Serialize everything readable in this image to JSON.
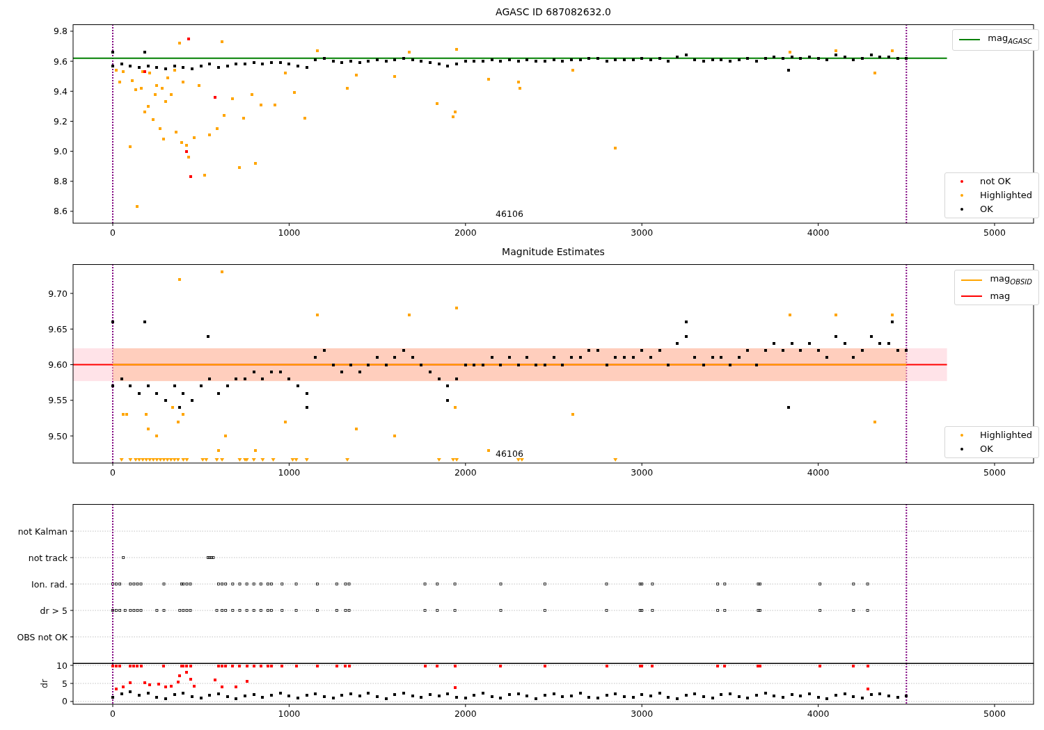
{
  "panels": [
    {
      "chart_data": {
        "type": "scatter",
        "title": "AGASC ID 687082632.0",
        "xlim": [
          -225,
          5221
        ],
        "ylim": [
          8.521,
          9.846
        ],
        "xticks": [
          0,
          1000,
          2000,
          3000,
          4000,
          5000
        ],
        "yticks": [
          {
            "value": 8.6,
            "label": "8.6"
          },
          {
            "value": 8.8,
            "label": "8.8"
          },
          {
            "value": 9.0,
            "label": "9.0"
          },
          {
            "value": 9.2,
            "label": "9.2"
          },
          {
            "value": 9.4,
            "label": "9.4"
          },
          {
            "value": 9.6,
            "label": "9.6"
          },
          {
            "value": 9.8,
            "label": "9.8"
          }
        ],
        "series": [
          {
            "name": "not OK",
            "color": "#ff0000",
            "x": [
              180,
              420,
              430,
              440,
              580
            ],
            "values": [
              9.53,
              9.0,
              9.75,
              8.83,
              9.36
            ]
          },
          {
            "name": "Highlighted",
            "color": "#ffa500",
            "x": [
              20,
              40,
              60,
              100,
              110,
              130,
              140,
              160,
              170,
              180,
              200,
              210,
              230,
              240,
              250,
              270,
              280,
              290,
              300,
              310,
              330,
              350,
              360,
              380,
              390,
              400,
              420,
              430,
              460,
              490,
              520,
              550,
              590,
              620,
              630,
              680,
              720,
              740,
              790,
              810,
              840,
              920,
              980,
              1030,
              1090,
              1160,
              1330,
              1380,
              1600,
              1680,
              1840,
              1930,
              1940,
              1950,
              2130,
              2300,
              2310,
              2610,
              2850,
              3840,
              4100,
              4320,
              4420
            ],
            "values": [
              9.54,
              9.46,
              9.53,
              9.03,
              9.47,
              9.41,
              8.63,
              9.42,
              9.53,
              9.26,
              9.3,
              9.52,
              9.21,
              9.38,
              9.44,
              9.15,
              9.42,
              9.08,
              9.33,
              9.49,
              9.38,
              9.54,
              9.13,
              9.72,
              9.06,
              9.46,
              9.04,
              8.96,
              9.09,
              9.44,
              8.84,
              9.11,
              9.15,
              9.73,
              9.24,
              9.35,
              8.89,
              9.22,
              9.38,
              8.92,
              9.31,
              9.31,
              9.52,
              9.39,
              9.22,
              9.67,
              9.42,
              9.51,
              9.5,
              9.66,
              9.32,
              9.23,
              9.26,
              9.68,
              9.48,
              9.46,
              9.42,
              9.54,
              9.02,
              9.66,
              9.67,
              9.52,
              9.67
            ]
          },
          {
            "name": "OK",
            "color": "#000000",
            "x": [
              0,
              50,
              100,
              150,
              200,
              250,
              300,
              350,
              400,
              450,
              500,
              550,
              600,
              650,
              700,
              750,
              800,
              850,
              900,
              950,
              1000,
              1050,
              1100,
              1150,
              1200,
              1250,
              1300,
              1350,
              1400,
              1450,
              1500,
              1550,
              1600,
              1650,
              1700,
              1750,
              1800,
              1850,
              1900,
              1950,
              2000,
              2050,
              2100,
              2150,
              2200,
              2250,
              2300,
              2350,
              2400,
              2450,
              2500,
              2550,
              2600,
              2650,
              2700,
              2750,
              2800,
              2850,
              2900,
              2950,
              3000,
              3050,
              3100,
              3150,
              3200,
              3250,
              3300,
              3350,
              3400,
              3450,
              3500,
              3550,
              3600,
              3650,
              3700,
              3750,
              3800,
              3850,
              3900,
              3950,
              4000,
              4050,
              4100,
              4150,
              4200,
              4250,
              4300,
              4350,
              4400,
              4450,
              4500,
              0,
              180,
              3830
            ],
            "values": [
              9.57,
              9.58,
              9.57,
              9.56,
              9.57,
              9.56,
              9.55,
              9.57,
              9.56,
              9.55,
              9.57,
              9.58,
              9.56,
              9.57,
              9.58,
              9.58,
              9.59,
              9.58,
              9.59,
              9.59,
              9.58,
              9.57,
              9.56,
              9.61,
              9.62,
              9.6,
              9.59,
              9.6,
              9.59,
              9.6,
              9.61,
              9.6,
              9.61,
              9.62,
              9.61,
              9.6,
              9.59,
              9.58,
              9.57,
              9.58,
              9.6,
              9.6,
              9.6,
              9.61,
              9.6,
              9.61,
              9.6,
              9.61,
              9.6,
              9.6,
              9.61,
              9.6,
              9.61,
              9.61,
              9.62,
              9.62,
              9.6,
              9.61,
              9.61,
              9.61,
              9.62,
              9.61,
              9.62,
              9.6,
              9.63,
              9.64,
              9.61,
              9.6,
              9.61,
              9.61,
              9.6,
              9.61,
              9.62,
              9.6,
              9.62,
              9.63,
              9.62,
              9.63,
              9.62,
              9.63,
              9.62,
              9.61,
              9.64,
              9.63,
              9.61,
              9.62,
              9.64,
              9.63,
              9.63,
              9.62,
              9.62,
              9.66,
              9.66,
              9.54
            ]
          }
        ],
        "ref_lines": [
          {
            "axis": "y",
            "value": 9.62,
            "label": "mag$_{AGASC}$",
            "color": "#008000"
          },
          {
            "axis": "x",
            "value": 0,
            "color": "#800080"
          },
          {
            "axis": "x",
            "value": 4500,
            "color": "#800080"
          }
        ],
        "annotations": [
          "46106"
        ]
      }
    },
    {
      "chart_data": {
        "type": "scatter",
        "title": "Magnitude Estimates",
        "xlim": [
          -225,
          5221
        ],
        "ylim": [
          9.462,
          9.741
        ],
        "xticks": [
          0,
          1000,
          2000,
          3000,
          4000,
          5000
        ],
        "yticks": [
          {
            "value": 9.5,
            "label": "9.50"
          },
          {
            "value": 9.55,
            "label": "9.55"
          },
          {
            "value": 9.6,
            "label": "9.60"
          },
          {
            "value": 9.65,
            "label": "9.65"
          },
          {
            "value": 9.7,
            "label": "9.70"
          }
        ],
        "series": [
          {
            "name": "Highlighted",
            "color": "#ffa500",
            "x": [
              60,
              80,
              190,
              200,
              250,
              340,
              370,
              380,
              400,
              620,
              640,
              600,
              810,
              980,
              1160,
              1380,
              1600,
              1680,
              1940,
              1950,
              2130,
              2610,
              3840,
              4100,
              4320,
              4420
            ],
            "values": [
              9.53,
              9.53,
              9.53,
              9.51,
              9.5,
              9.54,
              9.52,
              9.72,
              9.53,
              9.73,
              9.5,
              9.48,
              9.48,
              9.52,
              9.67,
              9.51,
              9.5,
              9.67,
              9.54,
              9.68,
              9.48,
              9.53,
              9.67,
              9.67,
              9.52,
              9.67
            ]
          },
          {
            "name": "OK",
            "color": "#000000",
            "x": [
              0,
              50,
              100,
              150,
              200,
              250,
              300,
              350,
              400,
              450,
              500,
              550,
              600,
              650,
              700,
              750,
              800,
              850,
              900,
              950,
              1000,
              1050,
              1100,
              1150,
              1200,
              1250,
              1300,
              1350,
              1400,
              1450,
              1500,
              1550,
              1600,
              1650,
              1700,
              1750,
              1800,
              1850,
              1900,
              1950,
              2000,
              2050,
              2100,
              2150,
              2200,
              2250,
              2300,
              2350,
              2400,
              2450,
              2500,
              2550,
              2600,
              2650,
              2700,
              2750,
              2800,
              2850,
              2900,
              2950,
              3000,
              3050,
              3100,
              3150,
              3200,
              3250,
              3300,
              3350,
              3400,
              3450,
              3500,
              3550,
              3600,
              3650,
              3700,
              3750,
              3800,
              3850,
              3900,
              3950,
              4000,
              4050,
              4100,
              4150,
              4200,
              4250,
              4300,
              4350,
              4400,
              4450,
              4500,
              0,
              180,
              540,
              3830,
              1100,
              380,
              1900,
              3250,
              4420
            ],
            "values": [
              9.57,
              9.58,
              9.57,
              9.56,
              9.57,
              9.56,
              9.55,
              9.57,
              9.56,
              9.55,
              9.57,
              9.58,
              9.56,
              9.57,
              9.58,
              9.58,
              9.59,
              9.58,
              9.59,
              9.59,
              9.58,
              9.57,
              9.56,
              9.61,
              9.62,
              9.6,
              9.59,
              9.6,
              9.59,
              9.6,
              9.61,
              9.6,
              9.61,
              9.62,
              9.61,
              9.6,
              9.59,
              9.58,
              9.57,
              9.58,
              9.6,
              9.6,
              9.6,
              9.61,
              9.6,
              9.61,
              9.6,
              9.61,
              9.6,
              9.6,
              9.61,
              9.6,
              9.61,
              9.61,
              9.62,
              9.62,
              9.6,
              9.61,
              9.61,
              9.61,
              9.62,
              9.61,
              9.62,
              9.6,
              9.63,
              9.64,
              9.61,
              9.6,
              9.61,
              9.61,
              9.6,
              9.61,
              9.62,
              9.6,
              9.62,
              9.63,
              9.62,
              9.63,
              9.62,
              9.63,
              9.62,
              9.61,
              9.64,
              9.63,
              9.61,
              9.62,
              9.64,
              9.63,
              9.63,
              9.62,
              9.62,
              9.66,
              9.66,
              9.64,
              9.54,
              9.54,
              9.54,
              9.55,
              9.66,
              9.66
            ]
          },
          {
            "color": "#ffa500",
            "marker": "v",
            "x": [
              50,
              100,
              130,
              150,
              170,
              190,
              210,
              230,
              250,
              270,
              290,
              310,
              330,
              350,
              370,
              400,
              420,
              510,
              530,
              590,
              620,
              720,
              750,
              760,
              800,
              850,
              910,
              1020,
              1040,
              1100,
              1330,
              1850,
              1930,
              1950,
              2300,
              2320,
              2850
            ],
            "values": [
              9.466,
              9.466,
              9.466,
              9.466,
              9.466,
              9.466,
              9.466,
              9.466,
              9.466,
              9.466,
              9.466,
              9.466,
              9.466,
              9.466,
              9.466,
              9.466,
              9.466,
              9.466,
              9.466,
              9.466,
              9.466,
              9.466,
              9.466,
              9.466,
              9.466,
              9.466,
              9.466,
              9.466,
              9.466,
              9.466,
              9.466,
              9.466,
              9.466,
              9.466,
              9.466,
              9.466,
              9.466
            ]
          }
        ],
        "bands": [
          {
            "axis": "y",
            "from": 9.577,
            "to": 9.623,
            "color": "#ffc0cb"
          },
          {
            "axis": "y",
            "from": 9.577,
            "to": 9.623,
            "color": "#ffb38a"
          }
        ],
        "ref_lines": [
          {
            "axis": "y",
            "value": 9.6,
            "label": "mag$_{OBSID}$",
            "color": "#ffa500"
          },
          {
            "axis": "y",
            "value": 9.6,
            "label": "mag",
            "color": "#ff0000"
          },
          {
            "axis": "x",
            "value": 0,
            "color": "#800080"
          },
          {
            "axis": "x",
            "value": 4500,
            "color": "#800080"
          }
        ],
        "annotations": [
          "46106"
        ]
      }
    },
    {
      "flags_plot": {
        "rows": [
          "not Kalman",
          "not track",
          "Ion. rad.",
          "dr > 5",
          "OBS not OK"
        ]
      }
    },
    {
      "chart_data": {
        "type": "scatter",
        "ylabel": "dr",
        "xlim": [
          -225,
          5221
        ],
        "ylim": [
          -0.77,
          10.58
        ],
        "grid": true,
        "xticks": [
          0,
          1000,
          2000,
          3000,
          4000,
          5000
        ],
        "yticks": [
          0,
          5,
          10
        ],
        "series": [
          {
            "color": "#ff0000",
            "x": [
              0,
              20,
              40,
              100,
              120,
              140,
              160,
              290,
              390,
              400,
              420,
              440,
              600,
              620,
              640,
              680,
              720,
              760,
              800,
              840,
              880,
              900,
              960,
              1040,
              1160,
              1270,
              1320,
              1340,
              1770,
              1840,
              1940,
              2200,
              2450,
              2800,
              2990,
              3000,
              3060,
              3430,
              3470,
              3660,
              3670,
              4010,
              4200,
              4280,
              20,
              60,
              100,
              180,
              210,
              260,
              300,
              330,
              370,
              380,
              420,
              440,
              460,
              580,
              620,
              700,
              760,
              1940,
              4280
            ],
            "values": [
              9.9,
              9.9,
              9.9,
              9.9,
              9.9,
              9.9,
              9.9,
              9.9,
              9.9,
              9.9,
              9.9,
              9.9,
              9.9,
              9.9,
              9.9,
              9.9,
              9.9,
              9.9,
              9.9,
              9.9,
              9.9,
              9.9,
              9.9,
              9.9,
              9.9,
              9.9,
              9.9,
              9.9,
              9.9,
              9.9,
              9.9,
              9.9,
              9.9,
              9.9,
              9.9,
              9.9,
              9.9,
              9.9,
              9.9,
              9.9,
              9.9,
              9.9,
              9.9,
              9.9,
              3.4,
              4.0,
              5.1,
              5.2,
              4.6,
              4.9,
              4.1,
              4.2,
              5.3,
              7.2,
              8.1,
              6.1,
              4.3,
              5.9,
              4.0,
              4.1,
              5.5,
              3.9,
              3.5
            ]
          },
          {
            "color": "#000000",
            "x": [
              0,
              50,
              100,
              150,
              200,
              250,
              300,
              350,
              400,
              450,
              500,
              550,
              600,
              650,
              700,
              750,
              800,
              850,
              900,
              950,
              1000,
              1050,
              1100,
              1150,
              1200,
              1250,
              1300,
              1350,
              1400,
              1450,
              1500,
              1550,
              1600,
              1650,
              1700,
              1750,
              1800,
              1850,
              1900,
              1950,
              2000,
              2050,
              2100,
              2150,
              2200,
              2250,
              2300,
              2350,
              2400,
              2450,
              2500,
              2550,
              2600,
              2650,
              2700,
              2750,
              2800,
              2850,
              2900,
              2950,
              3000,
              3050,
              3100,
              3150,
              3200,
              3250,
              3300,
              3350,
              3400,
              3450,
              3500,
              3550,
              3600,
              3650,
              3700,
              3750,
              3800,
              3850,
              3900,
              3950,
              4000,
              4050,
              4100,
              4150,
              4200,
              4250,
              4300,
              4350,
              4400,
              4450,
              4500
            ],
            "values": [
              1.2,
              2.1,
              2.6,
              1.8,
              2.4,
              1.1,
              0.8,
              1.9,
              2.3,
              1.4,
              0.9,
              1.7,
              2.2,
              1.3,
              0.7,
              1.6,
              2.0,
              1.2,
              1.8,
              2.4,
              1.5,
              0.9,
              1.7,
              2.2,
              1.4,
              1.0,
              1.8,
              2.1,
              1.5,
              2.4,
              1.3,
              0.8,
              1.9,
              2.3,
              1.5,
              1.1,
              2.0,
              1.6,
              2.2,
              1.2,
              0.9,
              1.8,
              2.3,
              1.4,
              1.0,
              1.9,
              2.2,
              1.5,
              0.8,
              1.7,
              2.1,
              1.3,
              1.6,
              2.3,
              1.2,
              0.9,
              1.8,
              2.2,
              1.4,
              1.1,
              2.0,
              1.5,
              2.3,
              1.2,
              0.8,
              1.7,
              2.1,
              1.4,
              1.0,
              1.9,
              2.2,
              1.3,
              0.9,
              1.8,
              2.3,
              1.5,
              1.1,
              2.0,
              1.6,
              2.2,
              1.2,
              0.8,
              1.7,
              2.1,
              1.4,
              1.0,
              1.9,
              2.2,
              1.5,
              1.2,
              1.6
            ]
          }
        ],
        "ref_lines": [
          {
            "axis": "x",
            "value": 0,
            "color": "#800080"
          },
          {
            "axis": "x",
            "value": 4500,
            "color": "#800080"
          }
        ]
      }
    }
  ]
}
